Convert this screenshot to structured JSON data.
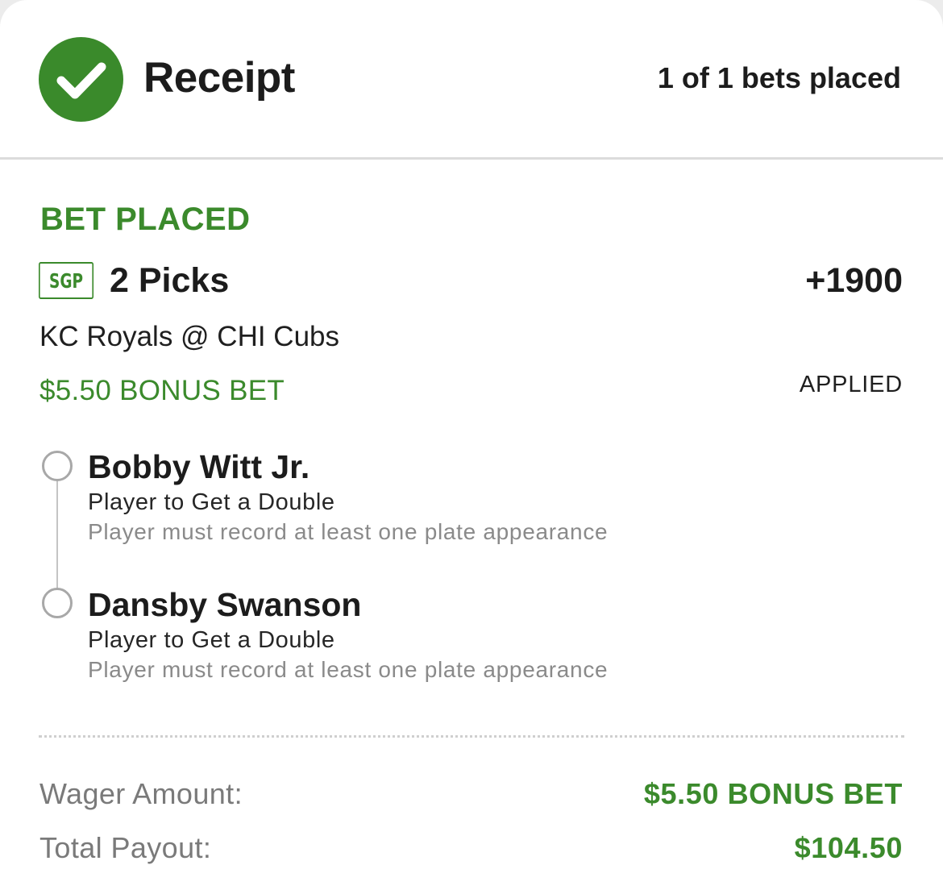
{
  "header": {
    "title": "Receipt",
    "bets_count": "1 of 1 bets placed"
  },
  "bet": {
    "status": "BET PLACED",
    "badge": "SGP",
    "picks": "2 Picks",
    "odds": "+1900",
    "matchup": "KC Royals @ CHI Cubs",
    "bonus_label": "$5.50 BONUS BET",
    "applied": "APPLIED",
    "legs": [
      {
        "player": "Bobby Witt Jr.",
        "market": "Player to Get a Double",
        "note": "Player must record at least one plate appearance"
      },
      {
        "player": "Dansby Swanson",
        "market": "Player to Get a Double",
        "note": "Player must record at least one plate appearance"
      }
    ]
  },
  "summary": {
    "wager_label": "Wager Amount:",
    "wager_value": "$5.50 BONUS BET",
    "payout_label": "Total Payout:",
    "payout_value": "$104.50"
  },
  "colors": {
    "accent_green": "#3b8a2c",
    "check_green": "#3a8a2b"
  },
  "icons": {
    "header_icon": "checkmark-circle-icon",
    "leg_marker": "empty-circle-icon"
  }
}
